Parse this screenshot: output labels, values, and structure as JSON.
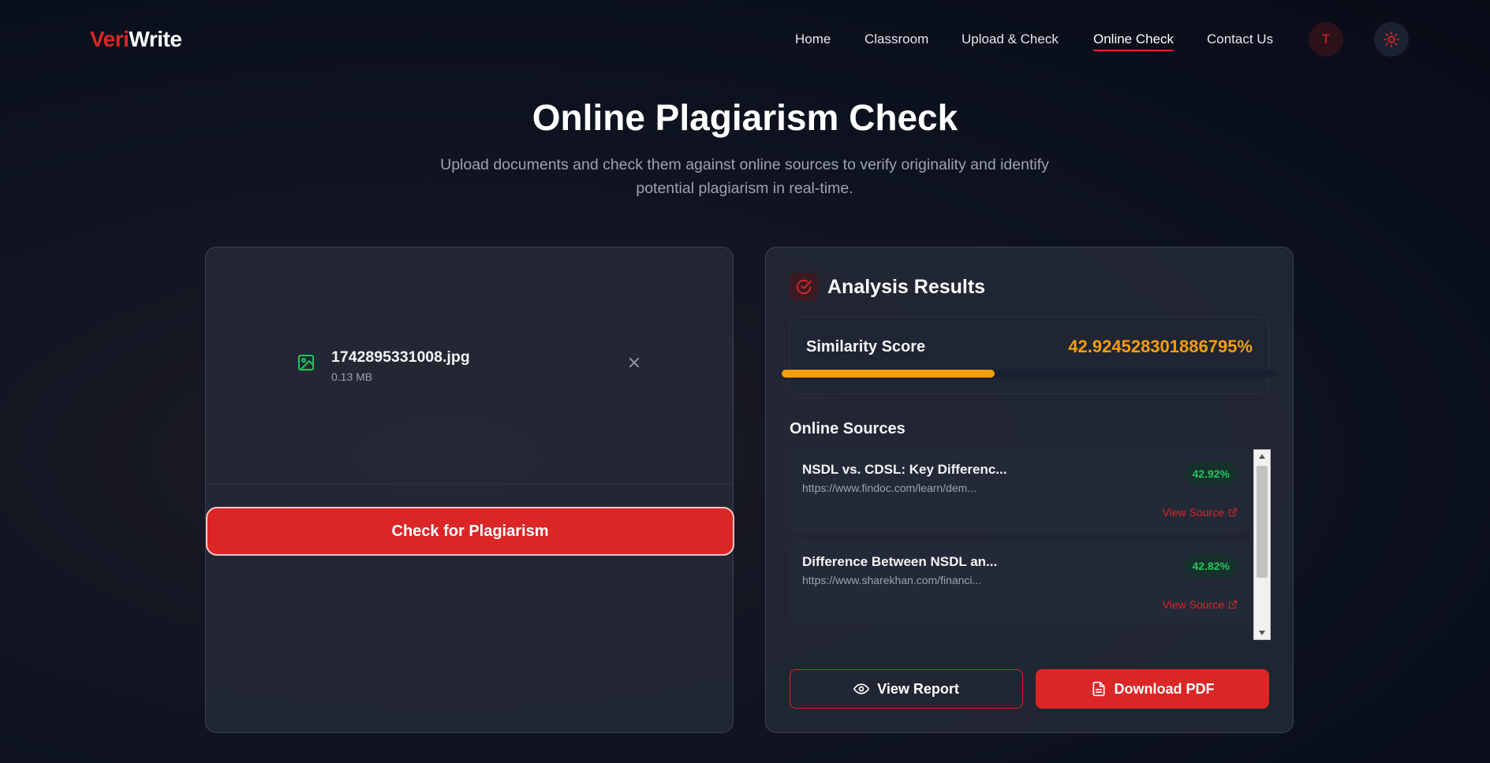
{
  "nav": {
    "logo_part1": "Veri",
    "logo_part2": "Write",
    "links": [
      "Home",
      "Classroom",
      "Upload & Check",
      "Online Check",
      "Contact Us"
    ],
    "active_link": "Online Check",
    "avatar_initial": "T",
    "theme_icon": "sun-icon"
  },
  "hero": {
    "title": "Online Plagiarism Check",
    "subtitle_line1": "Upload documents and check them against online sources to verify originality and identify",
    "subtitle_line2": "potential plagiarism in real-time."
  },
  "upload": {
    "file_name": "1742895331008.jpg",
    "file_size": "0.13 MB",
    "file_icon": "image-icon",
    "remove_icon": "close-icon",
    "check_button": "Check for Plagiarism"
  },
  "results": {
    "title": "Analysis Results",
    "title_icon": "check-circle-icon",
    "similarity_label": "Similarity Score",
    "similarity_value": "42.924528301886795%",
    "similarity_fraction": 0.4292,
    "sources_heading": "Online Sources",
    "sources": [
      {
        "title": "NSDL vs. CDSL: Key Differenc...",
        "url": "https://www.findoc.com/learn/dem...",
        "score": "42.92%",
        "link_label": "View Source"
      },
      {
        "title": "Difference Between NSDL an...",
        "url": "https://www.sharekhan.com/financi...",
        "score": "42.82%",
        "link_label": "View Source"
      }
    ],
    "view_report_button": "View Report",
    "download_pdf_button": "Download PDF"
  },
  "colors": {
    "accent": "#dc2626",
    "score": "#f59e0b",
    "badge": "#22c55e",
    "background": "#0b1120"
  }
}
